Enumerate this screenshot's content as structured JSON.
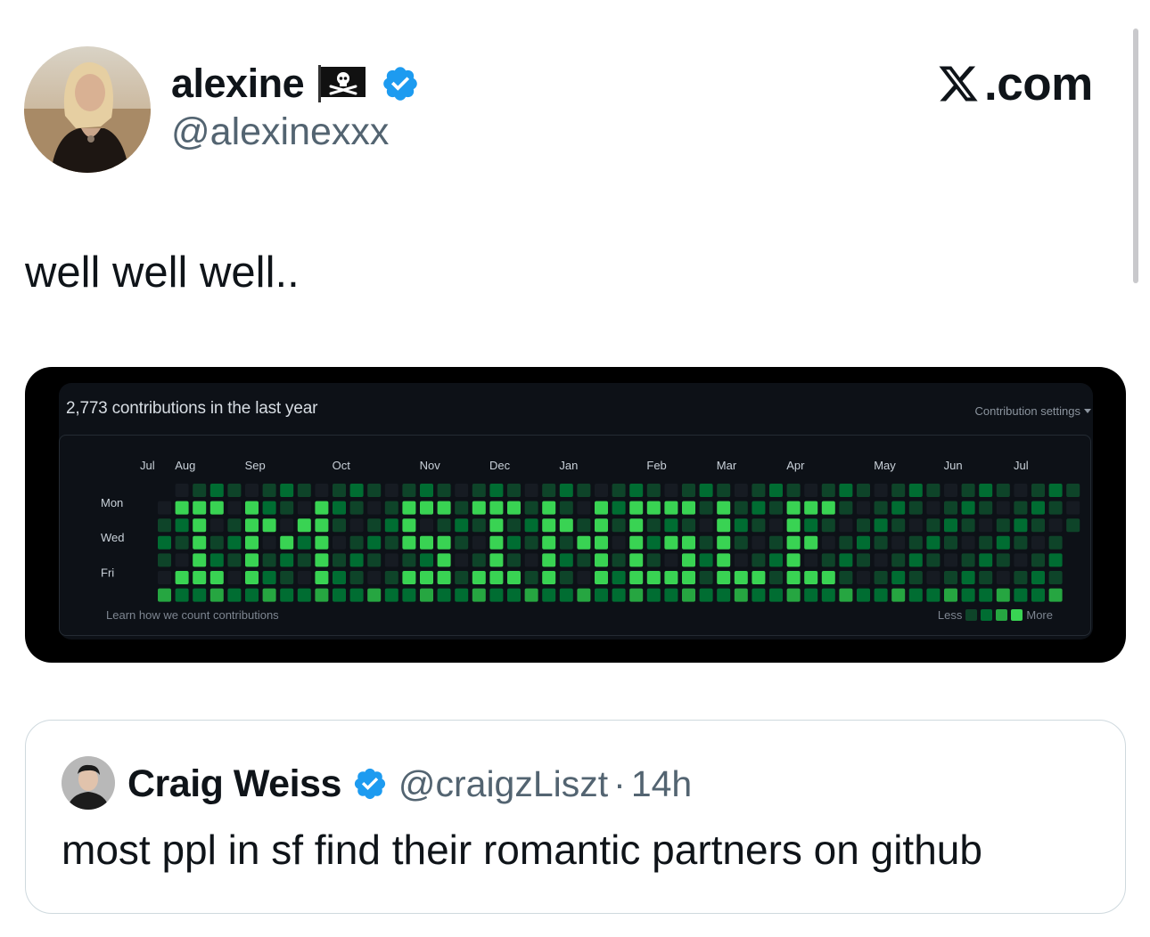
{
  "tweet": {
    "author": {
      "display_name": "alexine",
      "handle": "@alexinexxx",
      "flag_emoji": "pirate-flag-icon",
      "verified": true
    },
    "brand": {
      "text": ".com",
      "logo": "x-logo-icon"
    },
    "text": "well well well.."
  },
  "media": {
    "contributions_title": "2,773 contributions in the last year",
    "settings_label": "Contribution settings",
    "months": [
      "Jul",
      "Aug",
      "Sep",
      "Oct",
      "Nov",
      "Dec",
      "Jan",
      "Feb",
      "Mar",
      "Apr",
      "May",
      "Jun",
      "Jul"
    ],
    "days": [
      "Mon",
      "Wed",
      "Fri"
    ],
    "learn_label": "Learn how we count contributions",
    "legend_less": "Less",
    "legend_more": "More",
    "hidden_message": "IM SINGLE",
    "colors": {
      "level0": "#161b22",
      "level1": "#0e4429",
      "level2": "#006d32",
      "level3": "#26a641",
      "level4": "#39d353"
    }
  },
  "quoted_tweet": {
    "display_name": "Craig Weiss",
    "handle": "@craigzLiszt",
    "separator": "·",
    "time": "14h",
    "verified": true,
    "text": "most ppl in sf find their romantic partners on github"
  },
  "colors": {
    "text_primary": "#0f1419",
    "text_secondary": "#536471",
    "verified_blue": "#1d9bf0",
    "border": "#cfd9de"
  }
}
